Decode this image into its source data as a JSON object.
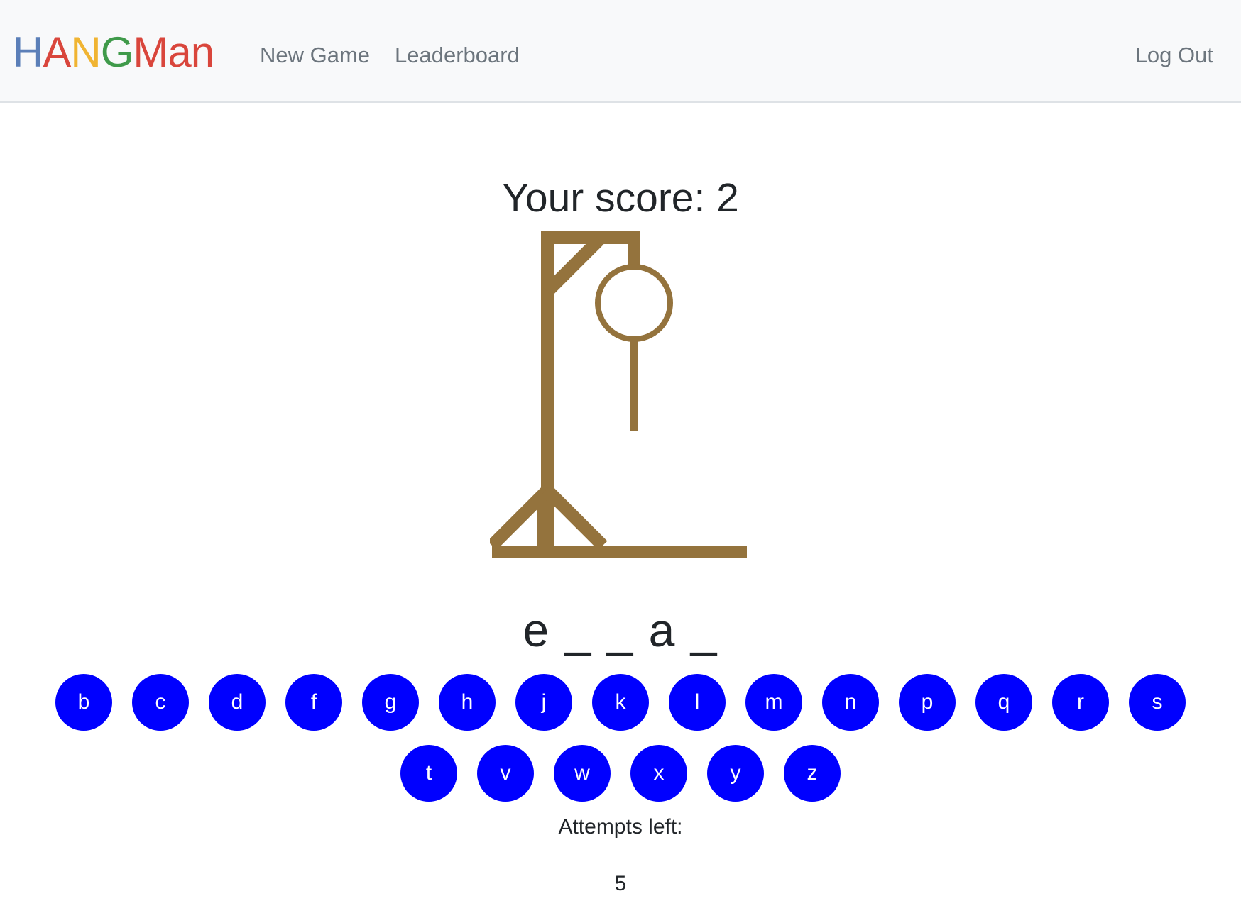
{
  "header": {
    "brand": {
      "letters": [
        {
          "char": "H",
          "color": "#5b7fb8"
        },
        {
          "char": "A",
          "color": "#d9463c"
        },
        {
          "char": "N",
          "color": "#f0b432"
        },
        {
          "char": "G",
          "color": "#3f9a4a"
        },
        {
          "char": "M",
          "color": "#d9463c"
        },
        {
          "char": "a",
          "color": "#d9463c"
        },
        {
          "char": "n",
          "color": "#d9463c"
        }
      ]
    },
    "nav": {
      "new_game": "New Game",
      "leaderboard": "Leaderboard",
      "log_out": "Log Out"
    }
  },
  "game": {
    "score_text": "Your score: 2",
    "word_display": "e _ _ a _",
    "gallows_color": "#94733d",
    "letters_row1": [
      "b",
      "c",
      "d",
      "f",
      "g",
      "h",
      "j",
      "k",
      "l",
      "m",
      "n",
      "p",
      "q",
      "r",
      "s"
    ],
    "letters_row2": [
      "t",
      "v",
      "w",
      "x",
      "y",
      "z"
    ],
    "letter_button_color": "#0000ff",
    "attempts_label": "Attempts left:",
    "attempts_value": "5"
  }
}
